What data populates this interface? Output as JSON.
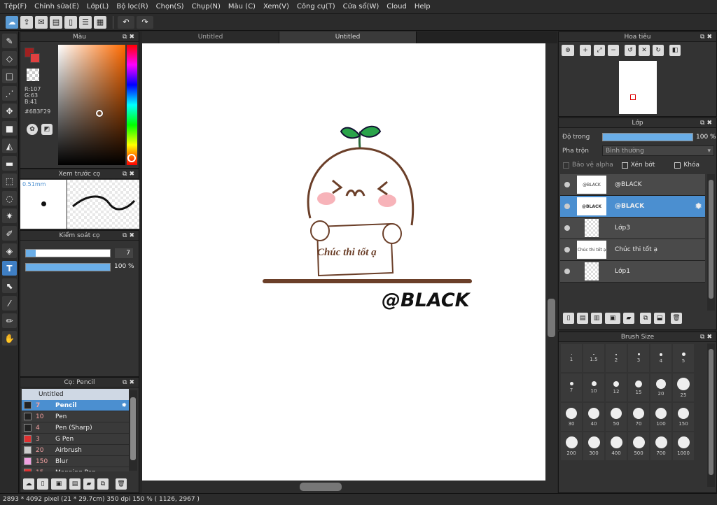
{
  "menu": [
    "Tệp(F)",
    "Chỉnh sửa(E)",
    "Lớp(L)",
    "Bộ lọc(R)",
    "Chọn(S)",
    "Chụp(N)",
    "Màu (C)",
    "Xem(V)",
    "Công cụ(T)",
    "Cửa sổ(W)",
    "Cloud",
    "Help"
  ],
  "tabs": [
    "Untitled",
    "Untitled"
  ],
  "color_panel": {
    "title": "Màu",
    "r": "R:107",
    "g": "G:63",
    "b": "B:41",
    "hex": "#6B3F29",
    "color": "#6B3F29"
  },
  "brush_preview": {
    "title": "Xem trước cọ",
    "size": "0.51mm"
  },
  "brush_control": {
    "title": "Kiểm soát cọ",
    "size_value": "7",
    "opacity_value": "100 %",
    "opacity_level": 100
  },
  "brush_list": {
    "title": "Cọ: Pencil",
    "group": "Untitled",
    "items": [
      {
        "size": "7",
        "name": "Pencil",
        "color": "#222222"
      },
      {
        "size": "10",
        "name": "Pen",
        "color": "#222222"
      },
      {
        "size": "4",
        "name": "Pen (Sharp)",
        "color": "#222222"
      },
      {
        "size": "3",
        "name": "G Pen",
        "color": "#e03030"
      },
      {
        "size": "20",
        "name": "Airbrush",
        "color": "#cccccc"
      },
      {
        "size": "150",
        "name": "Blur",
        "color": "#f0a0e0"
      },
      {
        "size": "15",
        "name": "Mapping Pen",
        "color": "#e03030"
      }
    ]
  },
  "navigator": {
    "title": "Hoa tiêu"
  },
  "layers": {
    "title": "Lớp",
    "opacity_label": "Độ trong",
    "opacity_value": "100 %",
    "opacity_level": 100,
    "blend_label": "Pha trộn",
    "blend_value": "Bình thường",
    "alpha_label": "Bảo vệ alpha",
    "clip_label": "Xén bớt",
    "lock_label": "Khóa",
    "items": [
      {
        "name": "@BLACK",
        "thumb": "@BLACK"
      },
      {
        "name": "@BLACK",
        "thumb": "@BLACK"
      },
      {
        "name": "Lớp3",
        "thumb": ""
      },
      {
        "name": "Chúc thi tốt ạ",
        "thumb": "Chúc thi tốt ạ"
      },
      {
        "name": "Lớp1",
        "thumb": ""
      }
    ]
  },
  "brush_size": {
    "title": "Brush Size",
    "sizes": [
      "1",
      "1.5",
      "2",
      "3",
      "4",
      "5",
      "7",
      "10",
      "12",
      "15",
      "20",
      "25",
      "30",
      "40",
      "50",
      "70",
      "100",
      "150",
      "200",
      "300",
      "400",
      "500",
      "700",
      "1000"
    ]
  },
  "artwork": {
    "text": "Chúc thi tốt ạ",
    "signature": "@BLACK"
  },
  "status": "2893 * 4092 pixel  (21 * 29.7cm)  350 dpi  150 %  ( 1126, 2967 )"
}
